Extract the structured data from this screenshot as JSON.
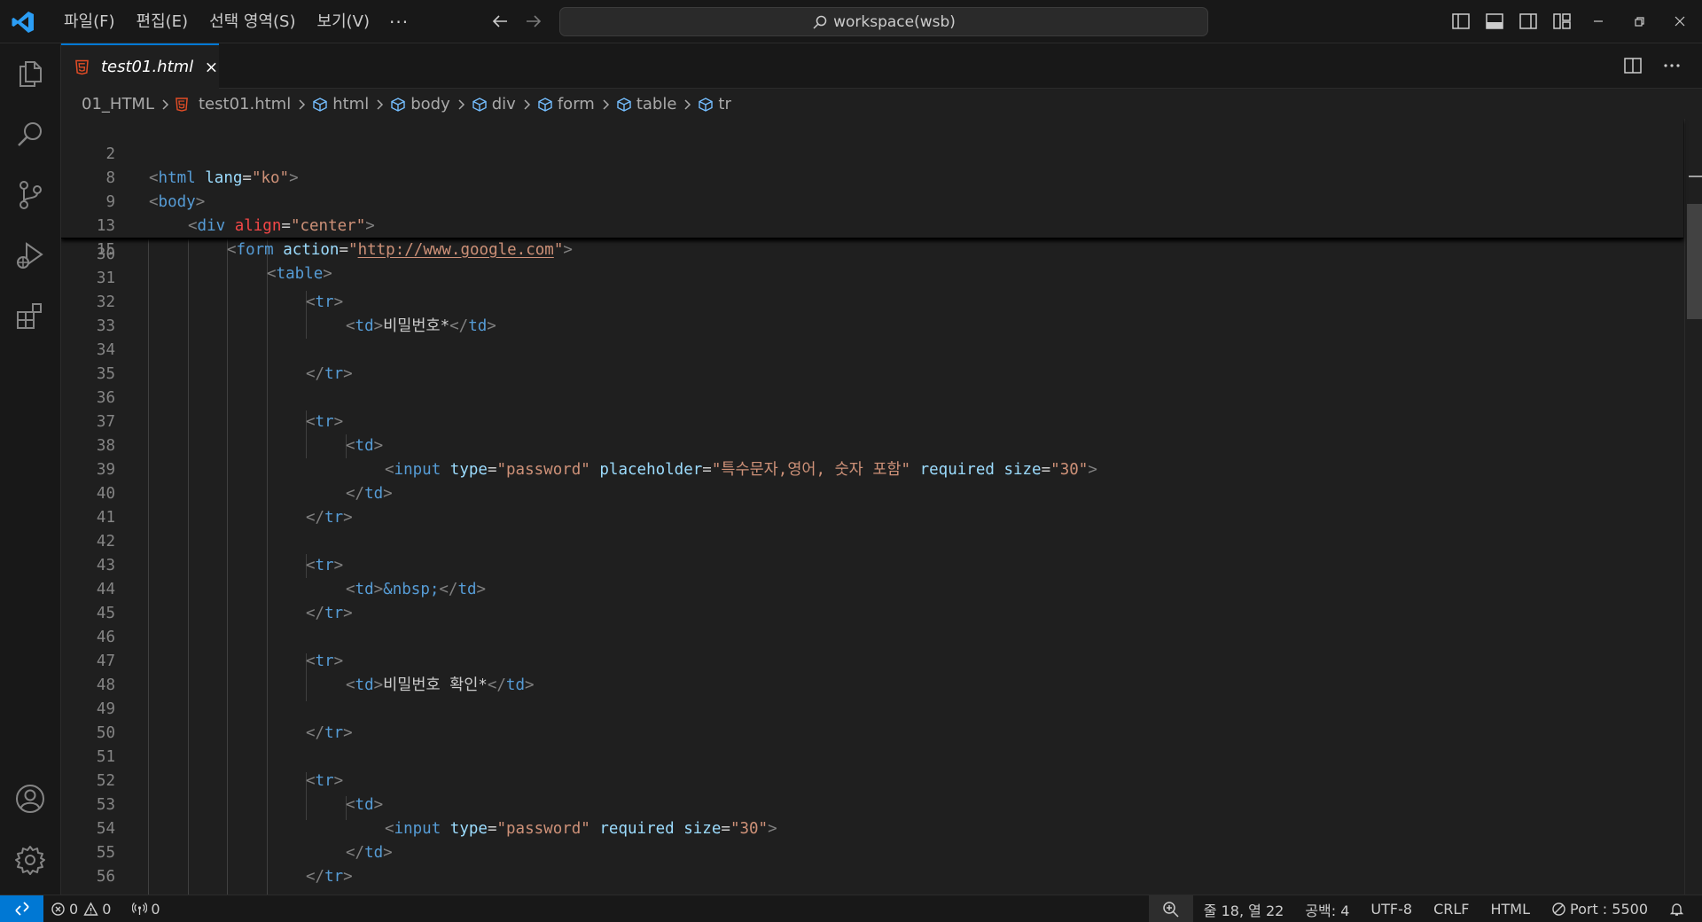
{
  "titlebar": {
    "menu": [
      "파일(F)",
      "편집(E)",
      "선택 영역(S)",
      "보기(V)"
    ],
    "more": "···",
    "search_text": "workspace(wsb)"
  },
  "tab": {
    "label": "test01.html"
  },
  "breadcrumb": {
    "folder": "01_HTML",
    "file": "test01.html",
    "symbols": [
      "html",
      "body",
      "div",
      "form",
      "table",
      "tr"
    ]
  },
  "sticky": [
    {
      "ln": "2",
      "s1": "html",
      "a1": "lang",
      "v1": "\"ko\""
    },
    {
      "ln": "8",
      "s1": "body"
    },
    {
      "ln": "9",
      "s1": "div",
      "a1": "align",
      "v1": "\"center\""
    },
    {
      "ln": "13",
      "s1": "form",
      "a1": "action",
      "v1q1": "\"",
      "v1": "http://www.google.com",
      "v1q2": "\""
    },
    {
      "ln": "15",
      "s1": "table"
    }
  ],
  "lines": {
    "l30": "30",
    "l31": "31",
    "l32": "32",
    "l33": "33",
    "l34": "34",
    "l35": "35",
    "l36": "36",
    "l37": "37",
    "l38": "38",
    "l39": "39",
    "l40": "40",
    "l41": "41",
    "l42": "42",
    "l43": "43",
    "l44": "44",
    "l45": "45",
    "l46": "46",
    "l47": "47",
    "l48": "48",
    "l49": "49",
    "l50": "50",
    "l51": "51",
    "l52": "52",
    "l53": "53",
    "l54": "54",
    "l55": "55",
    "l56": "56"
  },
  "code": {
    "tr": "tr",
    "td": "td",
    "input": "input",
    "pw_label": "비밀번호*",
    "pw_confirm_label": "비밀번호 확인*",
    "nbsp": "&nbsp;",
    "type_attr": "type",
    "type_val": "\"password\"",
    "placeholder_attr": "placeholder",
    "placeholder_val": "\"특수문자,영어, 숫자 포함\"",
    "required_attr": "required",
    "size_attr": "size",
    "size_val": "\"30\""
  },
  "statusbar": {
    "errors": "0",
    "warnings": "0",
    "ports": "0",
    "position": "줄 18, 열 22",
    "spaces": "공백: 4",
    "encoding": "UTF-8",
    "eol": "CRLF",
    "language": "HTML",
    "port": "Port : 5500"
  },
  "colors": {
    "accent": "#0078d4",
    "tag": "#569cd6",
    "attribute": "#9cdcfe",
    "string": "#ce9178",
    "html5_icon": "#e44d26"
  }
}
